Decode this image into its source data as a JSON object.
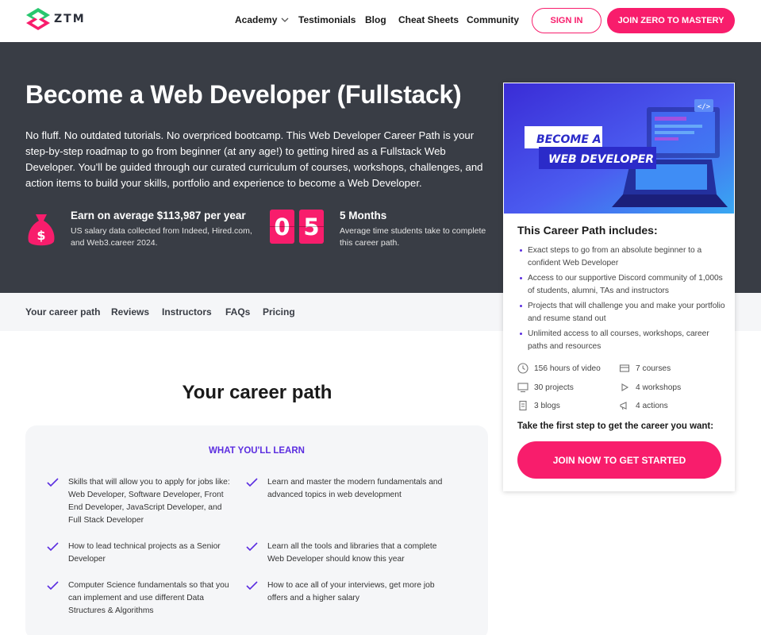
{
  "brand": {
    "name": "ZTM",
    "accent": "#f81d6c",
    "purple": "#5b2de0",
    "dark": "#393d45"
  },
  "header": {
    "nav": [
      "Academy",
      "Testimonials",
      "Blog",
      "Cheat Sheets",
      "Community"
    ],
    "signin_label": "SIGN IN",
    "join_label": "JOIN ZERO TO MASTERY"
  },
  "hero": {
    "title": "Become a Web Developer (Fullstack)",
    "description": "No fluff. No outdated tutorials. No overpriced bootcamp. This Web Developer Career Path is your step-by-step roadmap to go from beginner (at any age!) to getting hired as a Fullstack Web Developer. You'll be guided through our curated curriculum of courses, workshops, challenges, and action items to build your skills, portfolio and experience to become a Web Developer.",
    "salary_title": "Earn on average $113,987 per year",
    "salary_sub": "US salary data collected from Indeed, Hired.com, and Web3.career 2024.",
    "digits": [
      "0",
      "5"
    ],
    "months_title": "5 Months",
    "months_sub": "Average time students take to complete this career path."
  },
  "subnav": [
    "Your career path",
    "Reviews",
    "Instructors",
    "FAQs",
    "Pricing"
  ],
  "card": {
    "image_line1": "BECOME A",
    "image_line2": "WEB DEVELOPER",
    "title": "This Career Path includes:",
    "items": [
      "Exact steps to go from an absolute beginner to a confident Web Developer",
      "Access to our supportive Discord community of 1,000s of students, alumni, TAs and instructors",
      "Projects that will challenge you and make your portfolio and resume stand out",
      "Unlimited access to all courses, workshops, career paths and resources"
    ],
    "features": {
      "video": "156 hours of video",
      "courses": "7 courses",
      "projects": "30 projects",
      "workshops": "4 workshops",
      "blogs": "3 blogs",
      "actions": "4 actions"
    },
    "cta_label": "Take the first step to get the career you want:",
    "cta_button": "JOIN NOW TO GET STARTED"
  },
  "career": {
    "title": "Your career path",
    "heading": "WHAT YOU'LL LEARN",
    "items": [
      "Skills that will allow you to apply for jobs like: Web Developer, Software Developer, Front End Developer, JavaScript Developer, and Full Stack Developer",
      "Learn and master the modern fundamentals and advanced topics in web development",
      "How to lead technical projects as a Senior Developer",
      "Learn all the tools and libraries that a complete Web Developer should know this year",
      "Computer Science fundamentals so that you can implement and use different Data Structures & Algorithms",
      "How to ace all of your interviews, get more job offers and a higher salary"
    ]
  }
}
